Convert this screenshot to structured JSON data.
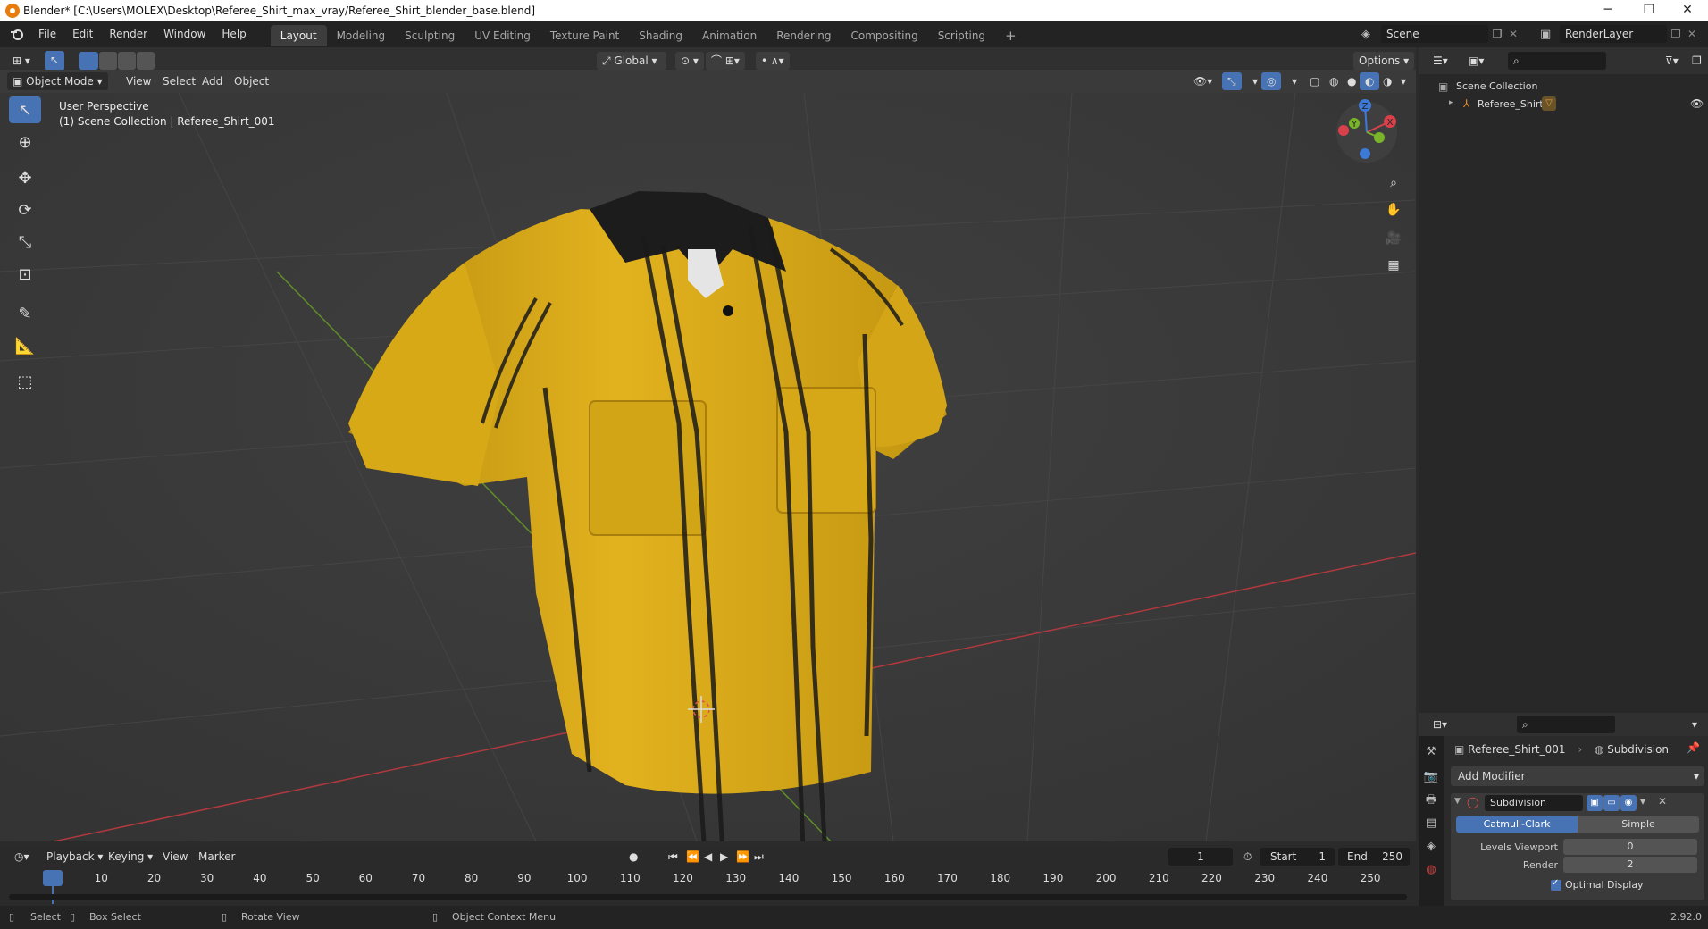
{
  "window": {
    "title": "Blender* [C:\\Users\\MOLEX\\Desktop\\Referee_Shirt_max_vray/Referee_Shirt_blender_base.blend]",
    "minimize": "─",
    "restore": "❐",
    "close": "✕"
  },
  "menu": [
    "File",
    "Edit",
    "Render",
    "Window",
    "Help"
  ],
  "workspaces": [
    "Layout",
    "Modeling",
    "Sculpting",
    "UV Editing",
    "Texture Paint",
    "Shading",
    "Animation",
    "Rendering",
    "Compositing",
    "Scripting"
  ],
  "active_workspace": "Layout",
  "scene": {
    "label": "Scene"
  },
  "render_layer": {
    "label": "RenderLayer"
  },
  "viewport_header": {
    "orientation": "Global",
    "options": "Options",
    "mode": "Object Mode",
    "menus": [
      "View",
      "Select",
      "Add",
      "Object"
    ]
  },
  "viewport": {
    "perspective": "User Perspective",
    "collection_info": "(1) Scene Collection | Referee_Shirt_001",
    "axis_x": "X",
    "axis_y": "Y",
    "axis_z": "Z"
  },
  "outliner": {
    "root": "Scene Collection",
    "items": [
      {
        "label": "Referee_Shirt"
      }
    ]
  },
  "properties": {
    "object_name": "Referee_Shirt_001",
    "modifier_crumb": "Subdivision",
    "add_modifier": "Add Modifier",
    "modifier": {
      "name": "Subdivision",
      "type_options": [
        "Catmull-Clark",
        "Simple"
      ],
      "selected_type": "Catmull-Clark",
      "levels_viewport_label": "Levels Viewport",
      "levels_viewport": "0",
      "render_label": "Render",
      "render": "2",
      "optimal_display": "Optimal Display"
    }
  },
  "timeline": {
    "menus": [
      "Playback",
      "Keying",
      "View",
      "Marker"
    ],
    "current_frame": "1",
    "start_label": "Start",
    "start": "1",
    "end_label": "End",
    "end": "250",
    "ticks": [
      "1",
      "10",
      "20",
      "30",
      "40",
      "50",
      "60",
      "70",
      "80",
      "90",
      "100",
      "110",
      "120",
      "130",
      "140",
      "150",
      "160",
      "170",
      "180",
      "190",
      "200",
      "210",
      "220",
      "230",
      "240",
      "250"
    ]
  },
  "statusbar": {
    "select": "Select",
    "box_select": "Box Select",
    "rotate_view": "Rotate View",
    "context_menu": "Object Context Menu",
    "version": "2.92.0"
  },
  "colors": {
    "accent": "#4772b3",
    "shirt": "#e1b21a",
    "x_axis": "#d8404a",
    "y_axis": "#79b42a",
    "z_axis": "#3d7ad8"
  }
}
